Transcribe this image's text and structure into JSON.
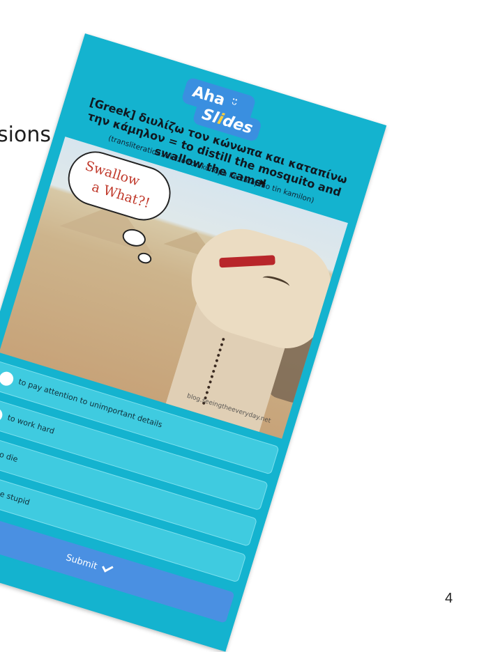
{
  "background": {
    "partial_text": "sions",
    "page_number": "4"
  },
  "logo": {
    "top": "Aha",
    "smile": "ᵕ̈",
    "bottom_pre": "Sl",
    "bottom_hl": "i",
    "bottom_post": "des"
  },
  "question": {
    "title": "[Greek] διυλίζω τον κώνωπα και καταπίνω την κάμηλον = to distill the mosquito and swallow the camel",
    "transliteration": "(transliteration: diilizo ton konopa ke katapino tin kamilon)"
  },
  "image": {
    "bubble_line1": "Swallow",
    "bubble_line2": "a What?!",
    "credit": "blog.seeingtheeveryday.net"
  },
  "options": [
    {
      "label": "to pay attention to unimportant details"
    },
    {
      "label": "to work hard"
    },
    {
      "label": "to die"
    },
    {
      "label": "to be stupid"
    }
  ],
  "submit_label": "Submit",
  "colors": {
    "card": "#14b3cf",
    "option": "#3fcbe0",
    "submit": "#4a90e2",
    "logo": "#3a8fe0"
  }
}
